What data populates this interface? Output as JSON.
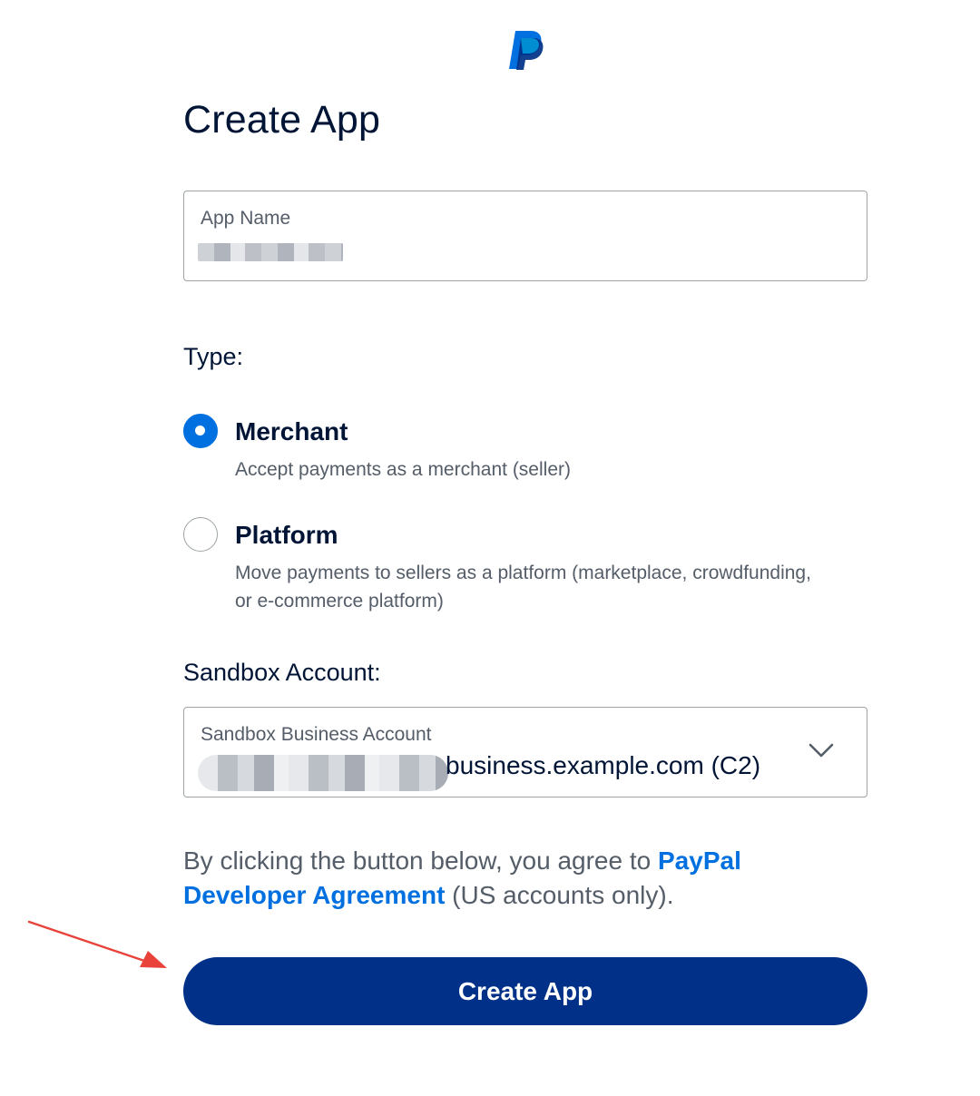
{
  "page": {
    "title": "Create App"
  },
  "app_name": {
    "label": "App Name",
    "value_redacted": true
  },
  "type": {
    "label": "Type:",
    "options": [
      {
        "title": "Merchant",
        "description": "Accept payments as a merchant (seller)",
        "checked": true
      },
      {
        "title": "Platform",
        "description": "Move payments to sellers as a platform (marketplace, crowdfunding, or e-commerce platform)",
        "checked": false
      }
    ]
  },
  "sandbox": {
    "section_label": "Sandbox Account:",
    "field_label": "Sandbox Business Account",
    "value_visible_part": "business.example.com (C2)"
  },
  "agreement": {
    "prefix": "By clicking the button below, you agree to ",
    "link_text": "PayPal Developer Agreement",
    "suffix": " (US accounts only)."
  },
  "actions": {
    "create_label": "Create App"
  },
  "icons": {
    "logo": "paypal-logo-icon",
    "dropdown": "chevron-down-icon",
    "annotation": "red-arrow-icon"
  },
  "colors": {
    "primary_button": "#003087",
    "accent": "#0070e0",
    "text_dark": "#001435",
    "text_muted": "#545d68",
    "annotation": "#e8423a"
  }
}
